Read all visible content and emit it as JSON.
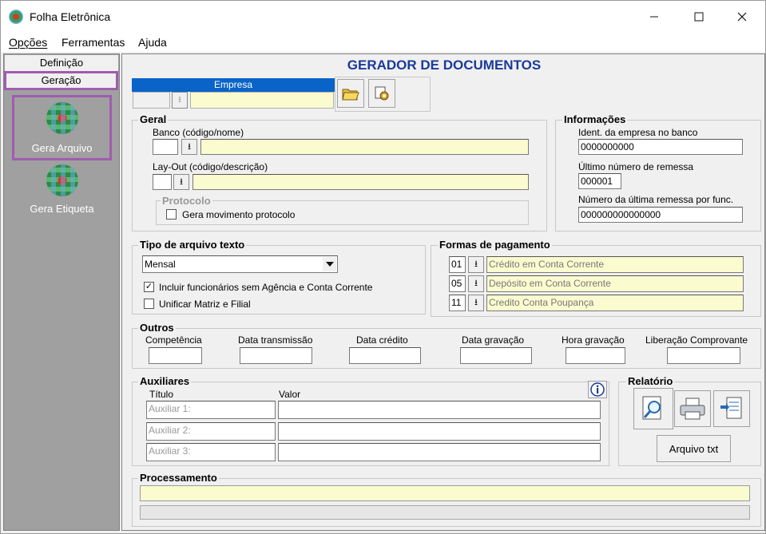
{
  "window": {
    "title": "Folha Eletrônica",
    "min_icon": "minimize-icon",
    "max_icon": "maximize-icon",
    "close_icon": "close-icon"
  },
  "menu": {
    "items": [
      "Opções",
      "Ferramentas",
      "Ajuda"
    ]
  },
  "sidebar": {
    "tabs": [
      "Definição",
      "Geração"
    ],
    "items": [
      {
        "label": "Gera Arquivo",
        "icon": "globe-icon"
      },
      {
        "label": "Gera Etiqueta",
        "icon": "globe-icon"
      }
    ]
  },
  "main": {
    "title": "GERADOR DE DOCUMENTOS",
    "empresa": {
      "header": "Empresa",
      "code": "",
      "name": ""
    },
    "geral": {
      "title": "Geral",
      "banco_label": "Banco (código/nome)",
      "banco_code": "",
      "banco_name": "",
      "layout_label": "Lay-Out (código/descrição)",
      "layout_code": "",
      "layout_name": "",
      "protocolo_title": "Protocolo",
      "protocolo_check": "Gera movimento protocolo"
    },
    "informacoes": {
      "title": "Informações",
      "ident_label": "Ident. da empresa no banco",
      "ident_value": "0000000000",
      "remessa_label": "Último número de remessa",
      "remessa_value": "000001",
      "func_label": "Número da última remessa por func.",
      "func_value": "000000000000000"
    },
    "tipo_arquivo": {
      "title": "Tipo de arquivo texto",
      "selected": "Mensal",
      "check1": "Incluir funcionários sem Agência e Conta Corrente",
      "check1_checked": "✓",
      "check2": "Unificar Matriz e Filial"
    },
    "formas": {
      "title": "Formas de pagamento",
      "rows": [
        {
          "code": "01",
          "desc": "Crédito em Conta Corrente"
        },
        {
          "code": "05",
          "desc": "Depósito em Conta Corrente"
        },
        {
          "code": "11",
          "desc": "Credito Conta Poupança"
        }
      ]
    },
    "outros": {
      "title": "Outros",
      "fields": [
        "Competência",
        "Data transmissão",
        "Data crédito",
        "Data gravação",
        "Hora gravação",
        "Liberação Comprovante"
      ]
    },
    "auxiliares": {
      "title": "Auxiliares",
      "col_titulo": "Título",
      "col_valor": "Valor",
      "rows": [
        {
          "title": "Auxiliar 1:",
          "value": ""
        },
        {
          "title": "Auxiliar 2:",
          "value": ""
        },
        {
          "title": "Auxiliar 3:",
          "value": ""
        }
      ]
    },
    "relatorio": {
      "title": "Relatório",
      "button": "Arquivo txt"
    },
    "processamento": {
      "title": "Processamento",
      "status": ""
    }
  },
  "colors": {
    "highlight": "#a05cb0",
    "title_blue": "#1a3a9a",
    "field_yellow": "#fbfbd0",
    "header_blue": "#0a64c8"
  }
}
